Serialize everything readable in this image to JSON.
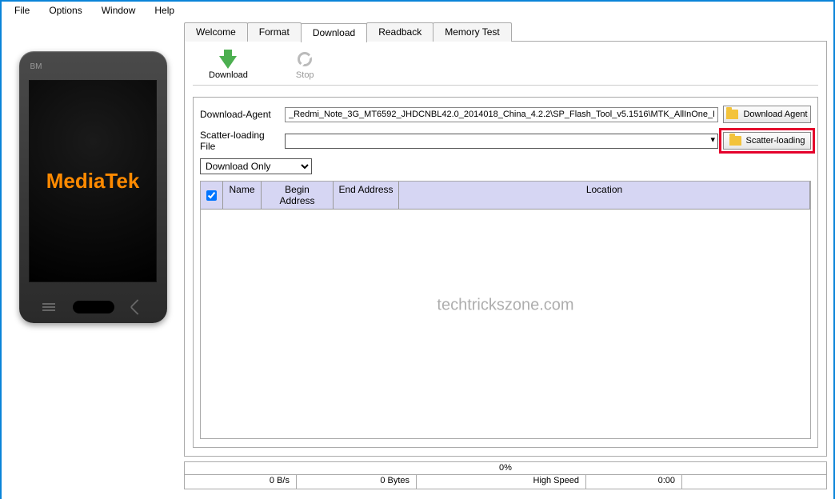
{
  "menu": {
    "file": "File",
    "options": "Options",
    "window": "Window",
    "help": "Help"
  },
  "phone": {
    "bm": "BM",
    "brand": "MediaTek"
  },
  "tabs": {
    "welcome": "Welcome",
    "format": "Format",
    "download": "Download",
    "readback": "Readback",
    "memtest": "Memory Test"
  },
  "toolbar": {
    "download": "Download",
    "stop": "Stop"
  },
  "form": {
    "da_label": "Download-Agent",
    "da_value": "_Redmi_Note_3G_MT6592_JHDCNBL42.0_2014018_China_4.2.2\\SP_Flash_Tool_v5.1516\\MTK_AllInOne_DA.bin",
    "da_button": "Download Agent",
    "scatter_label": "Scatter-loading File",
    "scatter_value": "",
    "scatter_button": "Scatter-loading",
    "mode_option": "Download Only"
  },
  "table": {
    "headers": {
      "chk": "",
      "name": "Name",
      "begin": "Begin Address",
      "end": "End Address",
      "location": "Location"
    }
  },
  "watermark": "techtrickszone.com",
  "status": {
    "progress": "0%",
    "speed": "0 B/s",
    "bytes": "0 Bytes",
    "mode": "High Speed",
    "time": "0:00"
  }
}
